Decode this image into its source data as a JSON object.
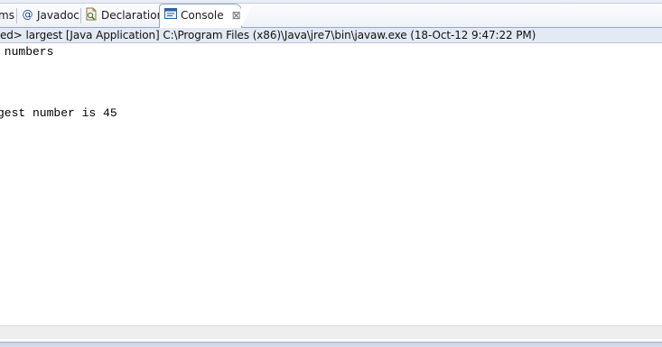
{
  "tabs": [
    {
      "label": "ms",
      "icon": "problems-icon",
      "active": false
    },
    {
      "label": "Javadoc",
      "icon": "at-icon",
      "active": false
    },
    {
      "label": "Declaration",
      "icon": "declaration-icon",
      "active": false
    },
    {
      "label": "Console",
      "icon": "console-icon",
      "active": true,
      "close": "⊠"
    }
  ],
  "description": "ed> largest [Java Application] C:\\Program Files (x86)\\Java\\jre7\\bin\\javaw.exe (18-Oct-12 9:47:22 PM)",
  "console": {
    "lines": [
      " numbers",
      "",
      "",
      "",
      "gest number is 45"
    ]
  },
  "colors": {
    "tab_bar_bg": "#eef2f8",
    "desc_bar_bg": "#e4eaf3",
    "tab_border": "#99a8c0",
    "console_bg": "#ffffff"
  }
}
